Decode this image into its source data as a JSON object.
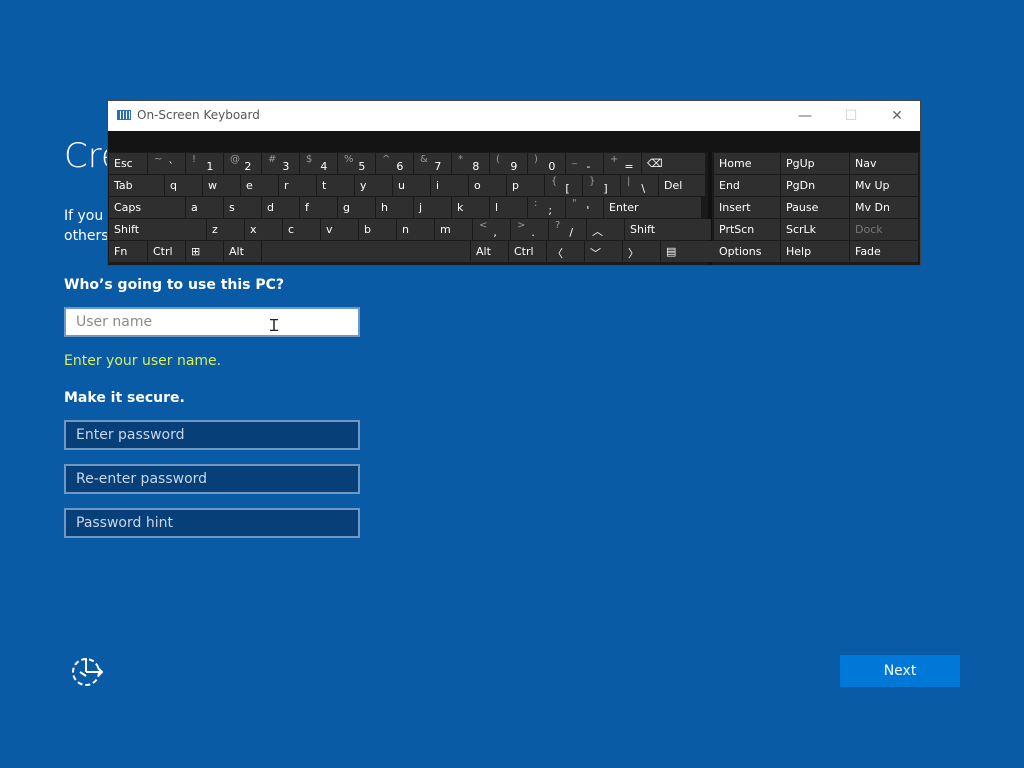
{
  "page": {
    "title": "Cre",
    "intro_line1": "If you v",
    "intro_line2": "others"
  },
  "form": {
    "who_label": "Who’s going to use this PC?",
    "username_placeholder": "User name",
    "username_hint": "Enter your user name.",
    "secure_label": "Make it secure.",
    "password_placeholder": "Enter password",
    "reenter_placeholder": "Re-enter password",
    "hint_placeholder": "Password hint",
    "hint_color": "#d7ee60"
  },
  "next_label": "Next",
  "accessibility_icon": "ease-of-access-icon",
  "osk": {
    "title": "On-Screen Keyboard",
    "minimize": "—",
    "maximize": "☐",
    "close": "✕",
    "row1": [
      {
        "main": "Esc"
      },
      {
        "main": "`",
        "sub": "~"
      },
      {
        "main": "1",
        "sub": "!"
      },
      {
        "main": "2",
        "sub": "@"
      },
      {
        "main": "3",
        "sub": "#"
      },
      {
        "main": "4",
        "sub": "$"
      },
      {
        "main": "5",
        "sub": "%"
      },
      {
        "main": "6",
        "sub": "^"
      },
      {
        "main": "7",
        "sub": "&"
      },
      {
        "main": "8",
        "sub": "*"
      },
      {
        "main": "9",
        "sub": "("
      },
      {
        "main": "0",
        "sub": ")"
      },
      {
        "main": "-",
        "sub": "_"
      },
      {
        "main": "=",
        "sub": "+"
      },
      {
        "main": "⌫"
      }
    ],
    "row2": [
      {
        "main": "Tab"
      },
      {
        "main": "q"
      },
      {
        "main": "w"
      },
      {
        "main": "e"
      },
      {
        "main": "r"
      },
      {
        "main": "t"
      },
      {
        "main": "y"
      },
      {
        "main": "u"
      },
      {
        "main": "i"
      },
      {
        "main": "o"
      },
      {
        "main": "p"
      },
      {
        "main": "[",
        "sub": "{"
      },
      {
        "main": "]",
        "sub": "}"
      },
      {
        "main": "\\",
        "sub": "|"
      },
      {
        "main": "Del"
      }
    ],
    "row3": [
      {
        "main": "Caps"
      },
      {
        "main": "a"
      },
      {
        "main": "s"
      },
      {
        "main": "d"
      },
      {
        "main": "f"
      },
      {
        "main": "g"
      },
      {
        "main": "h"
      },
      {
        "main": "j"
      },
      {
        "main": "k"
      },
      {
        "main": "l"
      },
      {
        "main": ";",
        "sub": ":"
      },
      {
        "main": "'",
        "sub": "\""
      },
      {
        "main": "Enter"
      }
    ],
    "row4": [
      {
        "main": "Shift"
      },
      {
        "main": "z"
      },
      {
        "main": "x"
      },
      {
        "main": "c"
      },
      {
        "main": "v"
      },
      {
        "main": "b"
      },
      {
        "main": "n"
      },
      {
        "main": "m"
      },
      {
        "main": ",",
        "sub": "<"
      },
      {
        "main": ".",
        "sub": ">"
      },
      {
        "main": "/",
        "sub": "?"
      },
      {
        "main": "︿"
      },
      {
        "main": "Shift"
      }
    ],
    "row5": [
      {
        "main": "Fn"
      },
      {
        "main": "Ctrl"
      },
      {
        "main": "⊞"
      },
      {
        "main": "Alt"
      },
      {
        "main": ""
      },
      {
        "main": "Alt"
      },
      {
        "main": "Ctrl"
      },
      {
        "main": "〈"
      },
      {
        "main": "﹀"
      },
      {
        "main": "〉"
      },
      {
        "main": "▤"
      }
    ],
    "nav": [
      [
        "Home",
        "PgUp",
        "Nav"
      ],
      [
        "End",
        "PgDn",
        "Mv Up"
      ],
      [
        "Insert",
        "Pause",
        "Mv Dn"
      ],
      [
        "PrtScn",
        "ScrLk",
        "Dock"
      ],
      [
        "Options",
        "Help",
        "Fade"
      ]
    ]
  }
}
